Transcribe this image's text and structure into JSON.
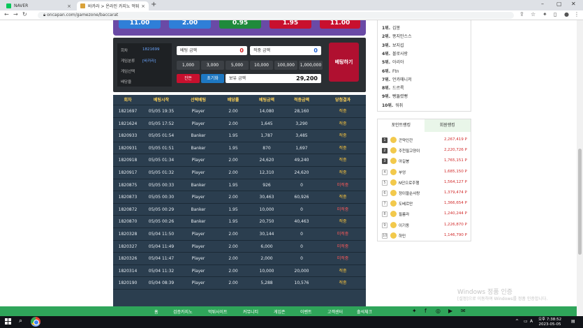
{
  "browser": {
    "tabs": [
      {
        "title": "NAVER",
        "fav_color": "#03c75a"
      },
      {
        "title": "바카라 > 온라인 카지노 먹튀 검...",
        "fav_color": "#d9a23a"
      }
    ],
    "url": "oncapan.com/gamezone/baccarat"
  },
  "game": {
    "score_buttons": [
      {
        "label": "11.00",
        "color": "#2f7fd8"
      },
      {
        "label": "2.00",
        "color": "#2f7fd8"
      },
      {
        "label": "0.95",
        "color": "#1f8a3c"
      },
      {
        "label": "1.95",
        "color": "#c8102e"
      },
      {
        "label": "11.00",
        "color": "#c8102e"
      }
    ]
  },
  "bet": {
    "info": [
      {
        "label": "회차",
        "value": "1821699"
      },
      {
        "label": "게임분류",
        "value": "[바카라]"
      },
      {
        "label": "게임선택",
        "value": ""
      },
      {
        "label": "배당율",
        "value": ""
      }
    ],
    "bet_amount_label": "베팅 금액",
    "bet_amount_value": "0",
    "win_amount_label": "적중 금액",
    "win_amount_value": "0",
    "chips": [
      "1,000",
      "3,000",
      "5,000",
      "10,000",
      "100,000",
      "1,000,000"
    ],
    "change_label": "잔돈",
    "reset_label": "초기화",
    "balance_label": "보유 금액",
    "balance_value": "29,200",
    "submit_label": "베팅하기"
  },
  "history": {
    "columns": [
      "회차",
      "베팅시작",
      "선택베팅",
      "배당률",
      "베팅금액",
      "적중금액",
      "당첨결과"
    ],
    "rows": [
      [
        "1821697",
        "05/05 19:35",
        "Player",
        "2.00",
        "14,080",
        "28,160",
        "적중"
      ],
      [
        "1821624",
        "05/05 17:52",
        "Player",
        "2.00",
        "1,645",
        "3,290",
        "적중"
      ],
      [
        "1820933",
        "05/05 01:54",
        "Banker",
        "1.95",
        "1,787",
        "3,485",
        "적중"
      ],
      [
        "1820931",
        "05/05 01:51",
        "Banker",
        "1.95",
        "870",
        "1,697",
        "적중"
      ],
      [
        "1820918",
        "05/05 01:34",
        "Player",
        "2.00",
        "24,620",
        "49,240",
        "적중"
      ],
      [
        "1820917",
        "05/05 01:32",
        "Player",
        "2.00",
        "12,310",
        "24,620",
        "적중"
      ],
      [
        "1820875",
        "05/05 00:33",
        "Banker",
        "1.95",
        "926",
        "0",
        "미적중"
      ],
      [
        "1820873",
        "05/05 00:30",
        "Player",
        "2.00",
        "30,463",
        "60,926",
        "적중"
      ],
      [
        "1820872",
        "05/05 00:29",
        "Banker",
        "1.95",
        "10,000",
        "0",
        "미적중"
      ],
      [
        "1820870",
        "05/05 00:26",
        "Banker",
        "1.95",
        "20,750",
        "40,463",
        "적중"
      ],
      [
        "1820328",
        "05/04 11:50",
        "Player",
        "2.00",
        "30,144",
        "0",
        "미적중"
      ],
      [
        "1820327",
        "05/04 11:49",
        "Player",
        "2.00",
        "6,000",
        "0",
        "미적중"
      ],
      [
        "1820326",
        "05/04 11:47",
        "Player",
        "2.00",
        "2,000",
        "0",
        "미적중"
      ],
      [
        "1820314",
        "05/04 11:32",
        "Player",
        "2.00",
        "10,000",
        "20,000",
        "적중"
      ],
      [
        "1820190",
        "05/04 08:39",
        "Player",
        "2.00",
        "5,288",
        "10,576",
        "적중"
      ]
    ],
    "win_text": "적중"
  },
  "rank_list": [
    {
      "no": "1위.",
      "name": "김봉"
    },
    {
      "no": "2위.",
      "name": "똥지만스스"
    },
    {
      "no": "3위.",
      "name": "보지섭"
    },
    {
      "no": "4위.",
      "name": "볼로사랑"
    },
    {
      "no": "5위.",
      "name": "아리아"
    },
    {
      "no": "6위.",
      "name": "Ftn"
    },
    {
      "no": "7위.",
      "name": "언카매니저"
    },
    {
      "no": "8위.",
      "name": "드르륵"
    },
    {
      "no": "9위.",
      "name": "뻥뚫렸뻥"
    },
    {
      "no": "10위.",
      "name": "워쥐"
    }
  ],
  "point_ranking": {
    "tabs": [
      "포인트랭킹",
      "회원랭킹"
    ],
    "rows": [
      {
        "rank": "1",
        "name": "곤약인간",
        "points": "2,267,419 P"
      },
      {
        "rank": "2",
        "name": "주천필고양이",
        "points": "2,220,726 P"
      },
      {
        "rank": "3",
        "name": "아길봉",
        "points": "1,765,151 P"
      },
      {
        "rank": "4",
        "name": "부엉",
        "points": "1,685,150 P"
      },
      {
        "rank": "5",
        "name": "N단으로주행",
        "points": "1,564,127 P"
      },
      {
        "rank": "6",
        "name": "정이팔순사랑",
        "points": "1,379,474 P"
      },
      {
        "rank": "7",
        "name": "도베르만",
        "points": "1,366,654 P"
      },
      {
        "rank": "8",
        "name": "필름라",
        "points": "1,240,244 P"
      },
      {
        "rank": "9",
        "name": "이기동",
        "points": "1,226,870 P"
      },
      {
        "rank": "10",
        "name": "하민",
        "points": "1,146,790 P"
      }
    ]
  },
  "footer": {
    "nav": [
      "홈",
      "검증카지노",
      "먹튀사이트",
      "커뮤니티",
      "게임존",
      "이벤트",
      "고객센터",
      "출석체크"
    ]
  },
  "watermark": {
    "title": "Windows 정품 인증",
    "sub": "[설정]으로 이동하여 Windows를 정품 인증합니다."
  },
  "taskbar": {
    "time": "오후 7:38:52",
    "date": "2023-05-05",
    "lang": "A"
  }
}
